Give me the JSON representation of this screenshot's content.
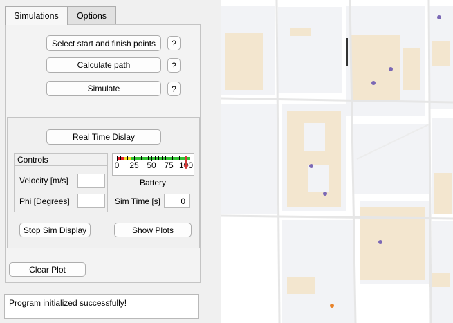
{
  "tabs": [
    {
      "label": "Simulations",
      "active": true
    },
    {
      "label": "Options",
      "active": false
    }
  ],
  "simulations": {
    "select_points_label": "Select start and finish points",
    "calculate_path_label": "Calculate path",
    "simulate_label": "Simulate",
    "help_label": "?"
  },
  "realtime": {
    "display_button_label": "Real Time Dislay",
    "controls_title": "Controls",
    "velocity_label": "Velocity [m/s]",
    "velocity_value": "",
    "phi_label": "Phi [Degrees]",
    "phi_value": "",
    "battery_label": "Battery",
    "battery_level": 100,
    "battery_ticks": [
      "0",
      "25",
      "50",
      "75",
      "100"
    ],
    "sim_time_label": "Sim Time [s]",
    "sim_time_value": "0",
    "stop_sim_label": "Stop Sim Display",
    "show_plots_label": "Show Plots"
  },
  "clear_plot_label": "Clear Plot",
  "status_message": "Program initialized successfully!",
  "colors": {
    "gauge_red": "#e8212b",
    "gauge_yellow": "#f4e22a",
    "gauge_green": "#34c234",
    "needle": "#d33a3a",
    "map_block": "#f2f3f6",
    "map_building": "#f3e6cf",
    "map_road": "#ffffff"
  }
}
